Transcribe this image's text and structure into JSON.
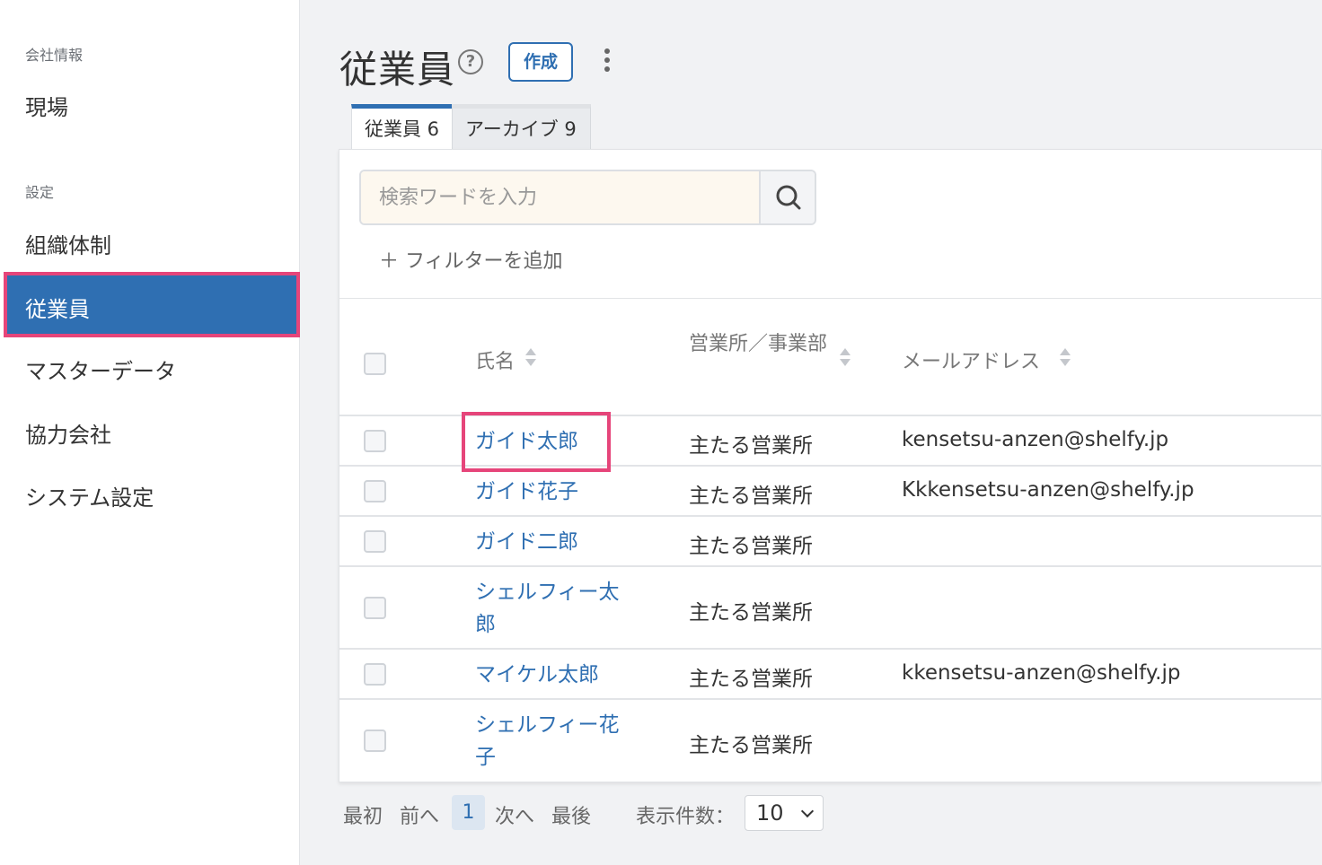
{
  "sidebar": {
    "section_company": "会社情報",
    "item_site": "現場",
    "section_settings": "設定",
    "item_org": "組織体制",
    "item_employees": "従業員",
    "item_master": "マスターデータ",
    "item_partner": "協力会社",
    "item_system": "システム設定"
  },
  "header": {
    "title": "従業員",
    "help_glyph": "?",
    "create_label": "作成"
  },
  "tabs": {
    "active": "従業員 6",
    "archive": "アーカイブ 9"
  },
  "search": {
    "placeholder": "検索ワードを入力",
    "value": ""
  },
  "filter": {
    "add_label": "＋ フィルターを追加"
  },
  "table": {
    "col_name": "氏名",
    "col_office": "営業所／事業部",
    "col_email": "メールアドレス",
    "rows": [
      {
        "name": "ガイド太郎",
        "office": "主たる営業所",
        "email": "kensetsu-anzen@shelfy.jp"
      },
      {
        "name": "ガイド花子",
        "office": "主たる営業所",
        "email": "Kkkensetsu-anzen@shelfy.jp"
      },
      {
        "name": "ガイド二郎",
        "office": "主たる営業所",
        "email": ""
      },
      {
        "name": "シェルフィー太郎",
        "office": "主たる営業所",
        "email": ""
      },
      {
        "name": "マイケル太郎",
        "office": "主たる営業所",
        "email": "kkensetsu-anzen@shelfy.jp"
      },
      {
        "name": "シェルフィー花子",
        "office": "主たる営業所",
        "email": ""
      }
    ]
  },
  "pagination": {
    "first": "最初",
    "prev": "前へ",
    "current": "1",
    "next": "次へ",
    "last": "最後",
    "per_page_label": "表示件数：",
    "per_page_value": "10"
  },
  "colors": {
    "accent": "#2f6fb2",
    "highlight": "#e6457a"
  }
}
